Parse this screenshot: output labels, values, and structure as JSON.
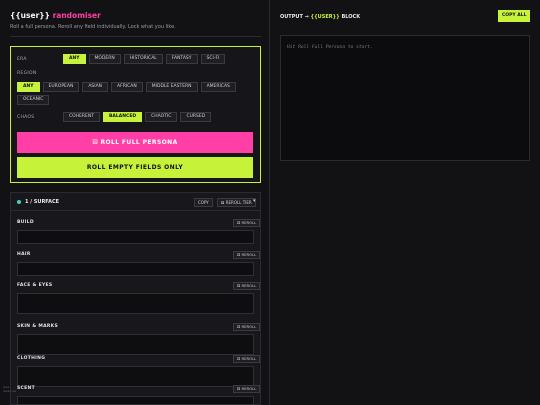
{
  "header": {
    "title_brace": "{{user}}",
    "title_word": "randomiser",
    "subtitle": "Roll a full persona. Reroll any field individually. Lock what you like."
  },
  "controls": {
    "era_label": "ERA",
    "era_options": [
      "ANY",
      "MODERN",
      "HISTORICAL",
      "FANTASY",
      "SCI-FI"
    ],
    "region_label": "REGION",
    "region_options": [
      "ANY",
      "EUROPEAN",
      "ASIAN",
      "AFRICAN",
      "MIDDLE EASTERN",
      "AMERICAS",
      "OCEANIC"
    ],
    "chaos_label": "CHAOS",
    "chaos_options": [
      "COHERENT",
      "BALANCED",
      "CHAOTIC",
      "CURSED"
    ],
    "selected": {
      "era": "ANY",
      "region": "ANY",
      "chaos": "BALANCED"
    },
    "roll_full_label": "⚄ ROLL FULL PERSONA",
    "roll_empty_label": "ROLL EMPTY FIELDS ONLY"
  },
  "tier": {
    "title": "1 / SURFACE",
    "copy_label": "COPY",
    "reroll_tier_label": "⚄ REROLL TIER",
    "chevron": "▾",
    "reroll_label": "⚄ REROLL",
    "fields": [
      {
        "label": "BUILD",
        "value": ""
      },
      {
        "label": "HAIR",
        "value": ""
      },
      {
        "label": "FACE & EYES",
        "value": ""
      },
      {
        "label": "SKIN & MARKS",
        "value": ""
      },
      {
        "label": "CLOTHING",
        "value": ""
      },
      {
        "label": "SCENT",
        "value": ""
      }
    ]
  },
  "output": {
    "title_prefix": "OUTPUT →",
    "title_highlight": "{{USER}}",
    "title_suffix": "BLOCK",
    "copy_all_label": "COPY ALL",
    "placeholder": "Hit Roll Full Persona to start."
  },
  "colors": {
    "accent_lime": "#c6f23a",
    "accent_pink": "#ff3fa6",
    "dot_teal": "#3ad4c0",
    "background": "#121215"
  }
}
